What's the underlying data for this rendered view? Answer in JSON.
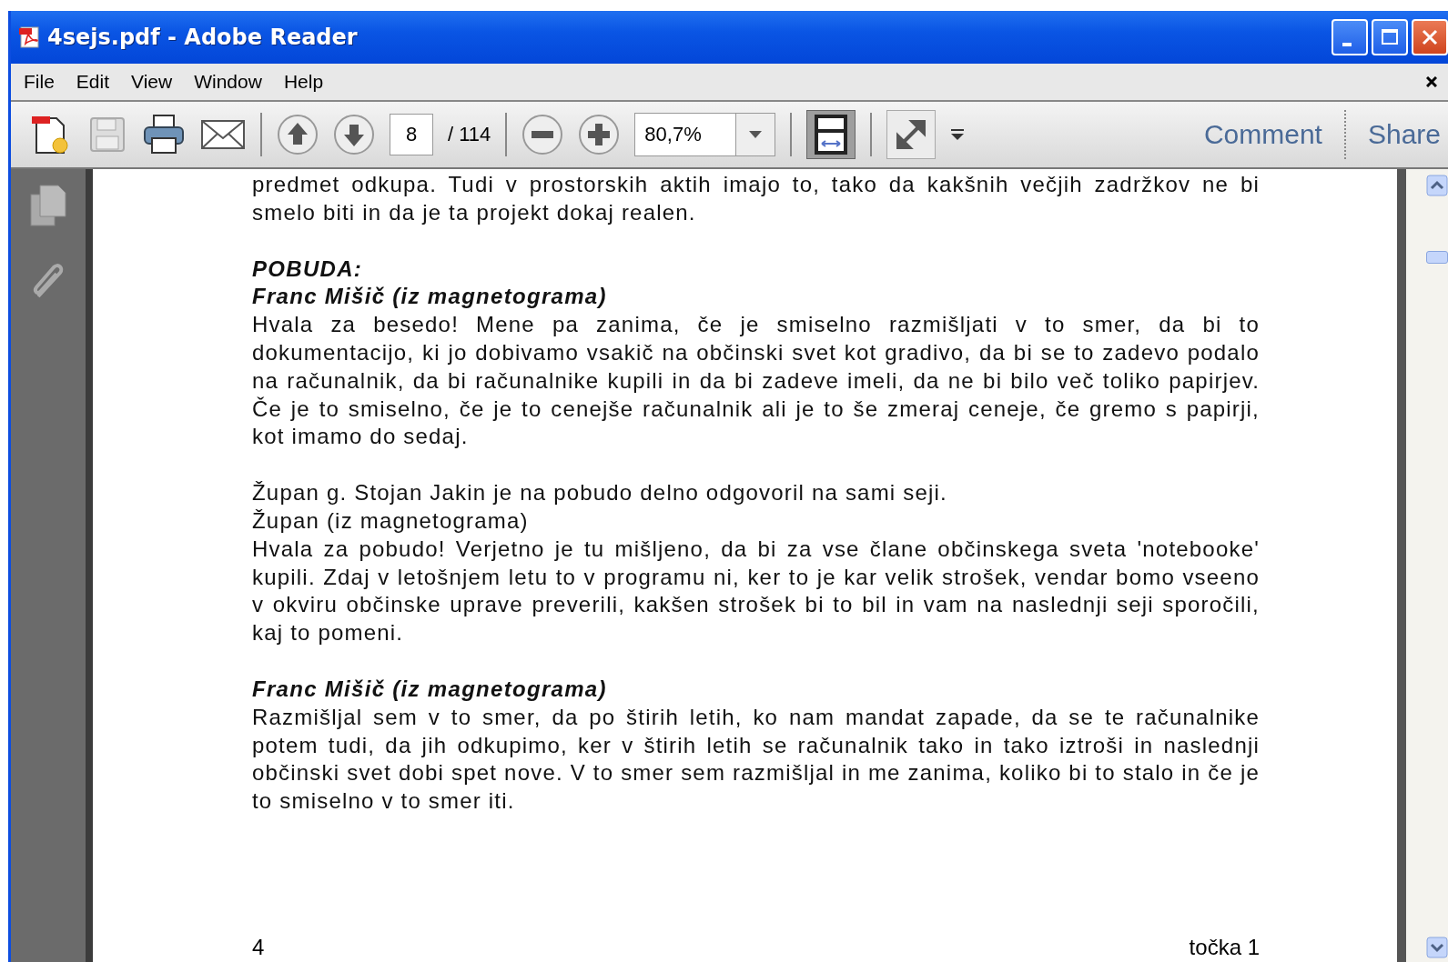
{
  "window": {
    "title": "4sejs.pdf - Adobe Reader"
  },
  "menu": [
    "File",
    "Edit",
    "View",
    "Window",
    "Help"
  ],
  "toolbar": {
    "page_number": "8",
    "page_count": "/ 114",
    "zoom": "80,7%",
    "fit_page_selected": true,
    "links": [
      "Comment",
      "Share"
    ]
  },
  "document": {
    "sections": [
      {
        "blocks": [
          {
            "kind": "text",
            "text": "predmet odkupa. Tudi v prostorskih aktih imajo to, tako da kakšnih večjih zadržkov ne bi smelo biti in da je ta projekt dokaj realen."
          }
        ]
      },
      {
        "blocks": [
          {
            "kind": "heading",
            "text": "POBUDA:"
          },
          {
            "kind": "heading",
            "text": "Franc Mišič (iz magnetograma)"
          },
          {
            "kind": "text",
            "text": "Hvala za besedo! Mene pa zanima, če je smiselno razmišljati v to smer, da bi to dokumentacijo, ki jo dobivamo vsakič na občinski svet kot gradivo, da bi se to zadevo podalo na računalnik, da bi računalnike kupili in da bi zadeve imeli, da ne bi bilo več toliko papirjev. Če je to smiselno, če je to cenejše računalnik ali je to še zmeraj ceneje, če gremo s papirji, kot imamo do sedaj."
          }
        ]
      },
      {
        "blocks": [
          {
            "kind": "text",
            "text": "Župan g. Stojan Jakin je na pobudo delno odgovoril na sami seji."
          },
          {
            "kind": "text",
            "text": "Župan (iz magnetograma)"
          },
          {
            "kind": "text",
            "text": "Hvala za pobudo! Verjetno je tu mišljeno, da bi za vse člane občinskega sveta 'notebooke' kupili. Zdaj v letošnjem letu to v programu ni, ker to je kar velik strošek, vendar bomo vseeno v okviru občinske uprave preverili, kakšen strošek bi to bil in vam na naslednji seji sporočili, kaj to pomeni."
          }
        ]
      },
      {
        "blocks": [
          {
            "kind": "heading",
            "text": "Franc Mišič (iz magnetograma)"
          },
          {
            "kind": "text",
            "text": "Razmišljal sem v to smer, da po štirih letih, ko nam mandat zapade, da se te računalnike potem tudi, da jih odkupimo, ker v štirih letih se računalnik tako in tako iztroši in naslednji občinski svet dobi spet nove. V to smer sem razmišljal in me zanima, koliko bi to stalo in če je to smiselno v to smer iti."
          }
        ]
      }
    ],
    "footer": {
      "page": "4",
      "section": "točka 1"
    }
  }
}
